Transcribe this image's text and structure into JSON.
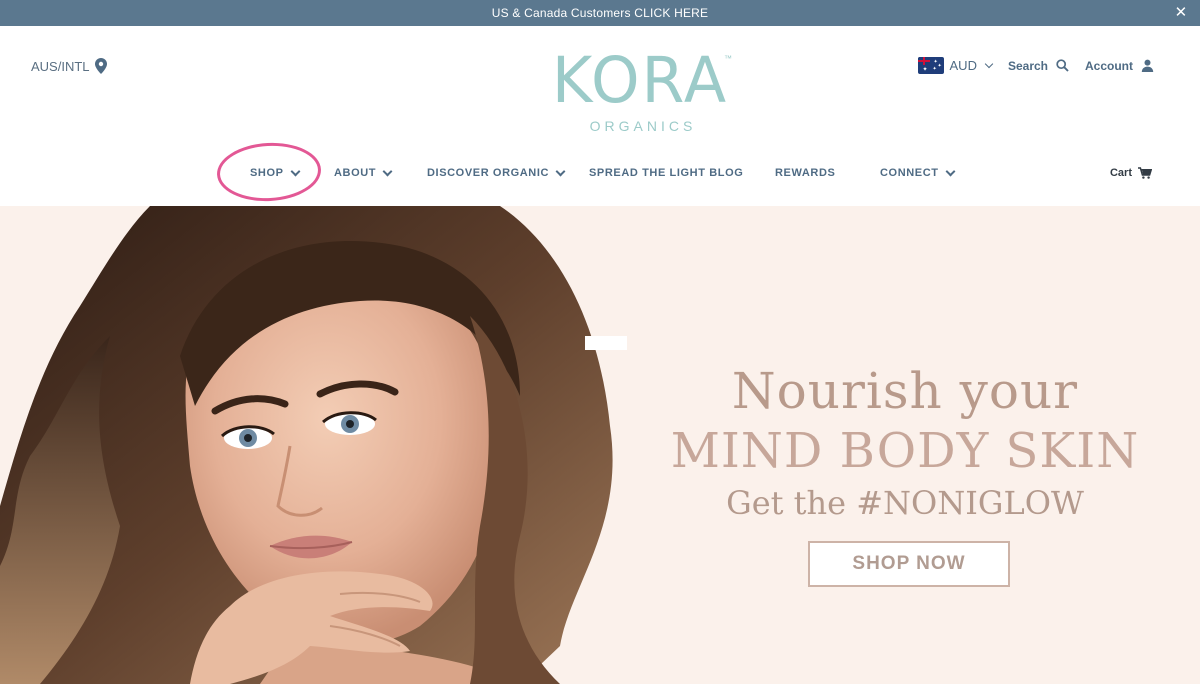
{
  "announcement": {
    "text": "US & Canada Customers CLICK HERE",
    "close_icon": "close-icon"
  },
  "header": {
    "region_label": "AUS/INTL",
    "logo": {
      "brand": "KORA",
      "tm": "™",
      "subtitle": "ORGANICS"
    },
    "currency": {
      "code": "AUD",
      "flag_icon": "australia-flag-icon"
    },
    "search_label": "Search",
    "account_label": "Account"
  },
  "nav": {
    "items": [
      {
        "label": "SHOP",
        "has_dropdown": true
      },
      {
        "label": "ABOUT",
        "has_dropdown": true
      },
      {
        "label": "DISCOVER ORGANIC",
        "has_dropdown": true
      },
      {
        "label": "SPREAD THE LIGHT BLOG",
        "has_dropdown": false
      },
      {
        "label": "REWARDS",
        "has_dropdown": false
      },
      {
        "label": "CONNECT",
        "has_dropdown": true
      }
    ],
    "cart_label": "Cart"
  },
  "hero": {
    "line1": "Nourish your",
    "line2": "MIND BODY SKIN",
    "line3": "Get the #NONIGLOW",
    "cta_label": "SHOP NOW"
  },
  "colors": {
    "announce_bg": "#5b788f",
    "brand_teal": "#9ccbc9",
    "nav_text": "#4f6b84",
    "hero_bg": "#fbf1eb",
    "hero_text": "#b89a8b",
    "highlight_circle": "#e0468a"
  }
}
